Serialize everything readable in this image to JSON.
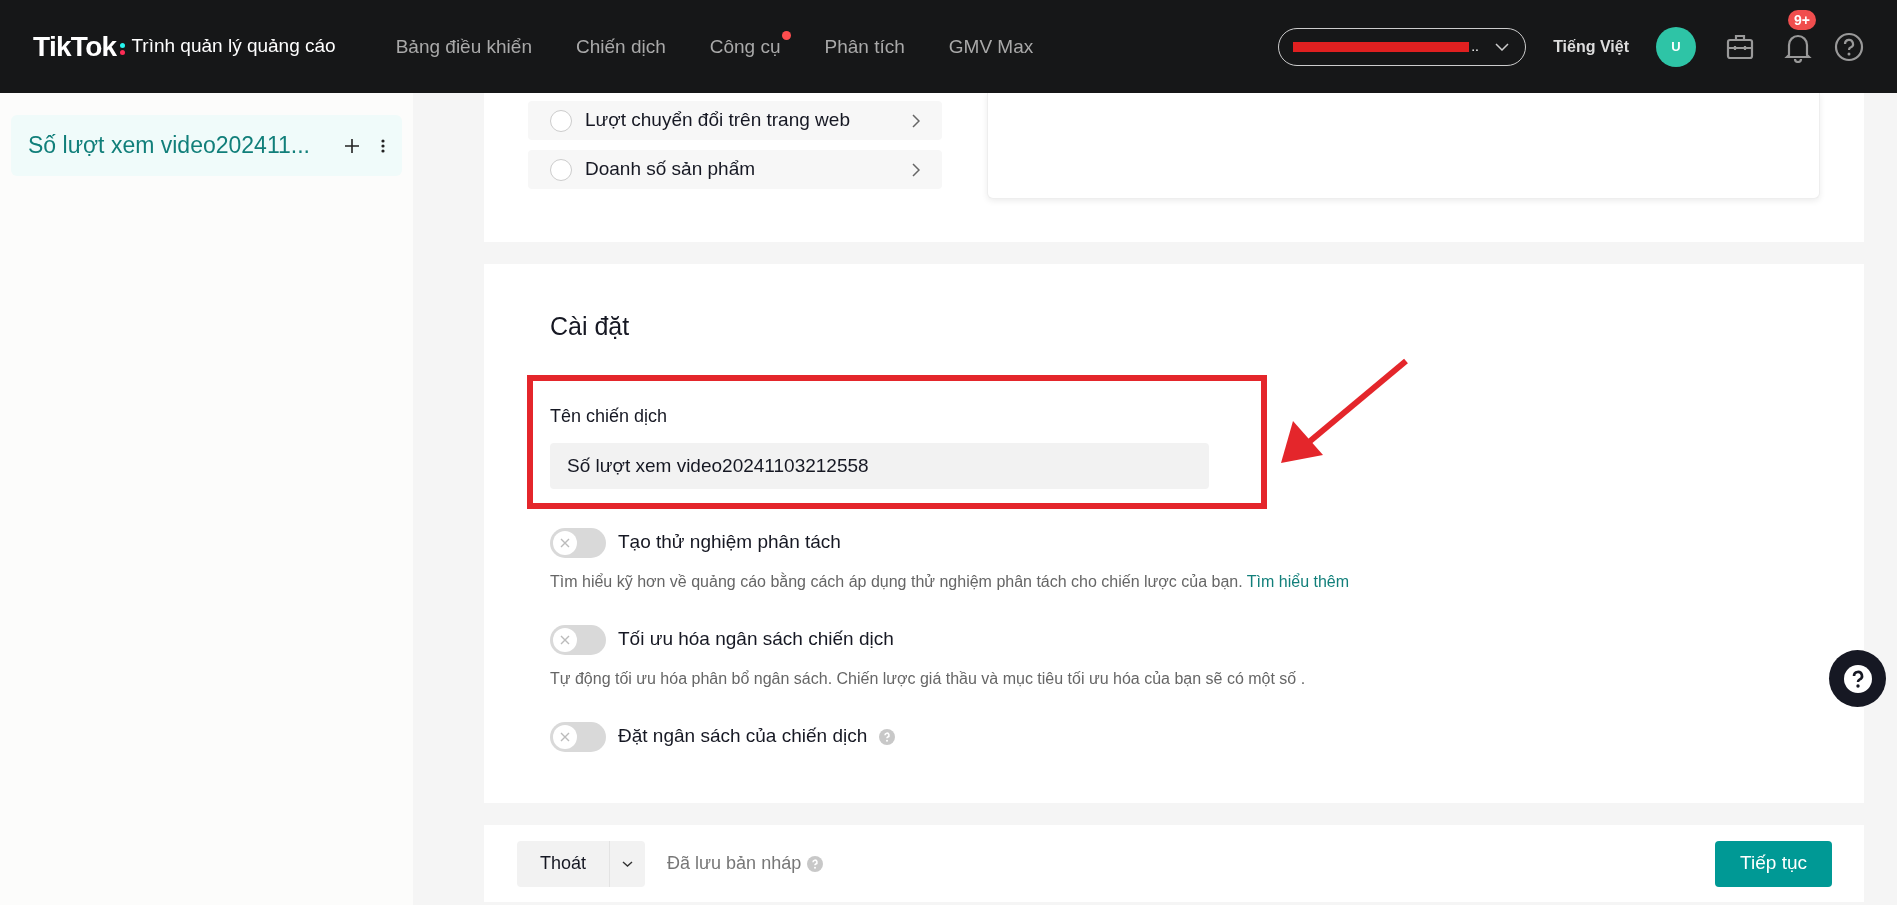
{
  "header": {
    "logo": "TikTok",
    "logo_subtitle": "Trình quản lý quảng cáo",
    "nav": [
      {
        "label": "Bảng điều khiển",
        "dot": false
      },
      {
        "label": "Chiến dịch",
        "dot": false
      },
      {
        "label": "Công cụ",
        "dot": true
      },
      {
        "label": "Phân tích",
        "dot": false
      },
      {
        "label": "GMV Max",
        "dot": false
      }
    ],
    "account": "..",
    "language": "Tiếng Việt",
    "avatar": "U",
    "notification_badge": "9+"
  },
  "sidebar": {
    "items": [
      {
        "label": "Số lượt xem video202411...",
        "selected": true
      }
    ]
  },
  "objectives": [
    {
      "label": "Lượt chuyển đổi trên trang web",
      "selected": false
    },
    {
      "label": "Doanh số sản phẩm",
      "selected": false
    }
  ],
  "settings": {
    "title": "Cài đặt",
    "name_label": "Tên chiến dịch",
    "name_value": "Số lượt xem video20241103212558",
    "toggles": [
      {
        "label": "Tạo thử nghiệm phân tách",
        "on": false,
        "help": false,
        "description": "Tìm hiểu kỹ hơn về quảng cáo bằng cách áp dụng thử nghiệm phân tách cho chiến lược của bạn.",
        "link": "Tìm hiểu thêm"
      },
      {
        "label": "Tối ưu hóa ngân sách chiến dịch",
        "on": false,
        "help": false,
        "description": "Tự động tối ưu hóa phân bổ ngân sách. Chiến lược giá thầu và mục tiêu tối ưu hóa của bạn sẽ có một số ."
      },
      {
        "label": "Đặt ngân sách của chiến dịch",
        "on": false,
        "help": true
      }
    ]
  },
  "footer": {
    "exit": "Thoát",
    "draft_status": "Đã lưu bản nháp",
    "continue": "Tiếp tục"
  }
}
